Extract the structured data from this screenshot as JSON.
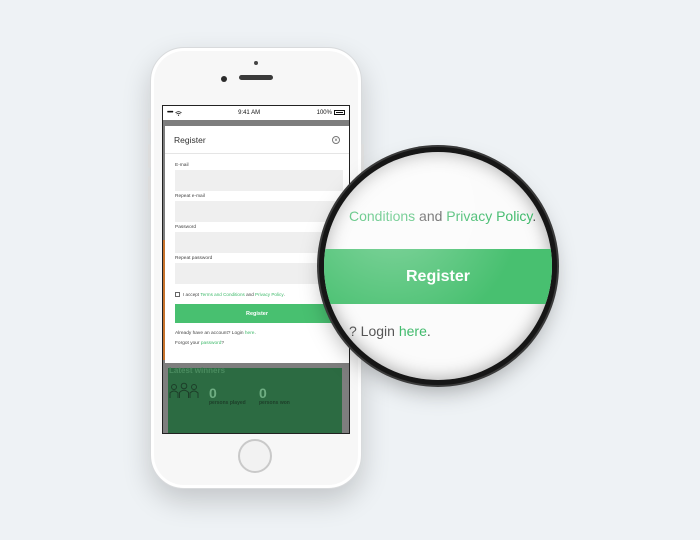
{
  "status_bar": {
    "signal": "•••••",
    "wifi_icon": "wifi-icon",
    "time": "9:41 AM",
    "battery": "100%"
  },
  "modal": {
    "title": "Register",
    "close_icon": "close-icon",
    "fields": [
      {
        "label": "E-mail",
        "value": ""
      },
      {
        "label": "Repeat e-mail",
        "value": ""
      },
      {
        "label": "Password",
        "value": ""
      },
      {
        "label": "Repeat password",
        "value": ""
      }
    ],
    "terms": {
      "prefix": "I accept ",
      "link1": "Terms and Conditions",
      "middle": " and ",
      "link2": "Privacy Policy",
      "suffix": "."
    },
    "register_label": "Register",
    "login_line": {
      "prefix": "Already have an account? Login ",
      "link": "here",
      "suffix": "."
    },
    "forgot_line": {
      "prefix": "Forgot your ",
      "link": "password",
      "suffix": "?"
    }
  },
  "background": {
    "latest_title": "Latest winners",
    "stats": [
      {
        "num": "0",
        "label": "persons played"
      },
      {
        "num": "0",
        "label": "persons won"
      }
    ]
  },
  "magnifier": {
    "terms_link": "Conditions",
    "terms_middle": " and ",
    "terms_link2": "Privacy Policy",
    "terms_suffix": ".",
    "button_label": "Register",
    "login_prefix": "? Login ",
    "login_link": "here",
    "login_suffix": "."
  },
  "colors": {
    "accent": "#48c070",
    "link": "#3fba6b",
    "background": "#eef2f5",
    "band": "#2c6b42"
  }
}
